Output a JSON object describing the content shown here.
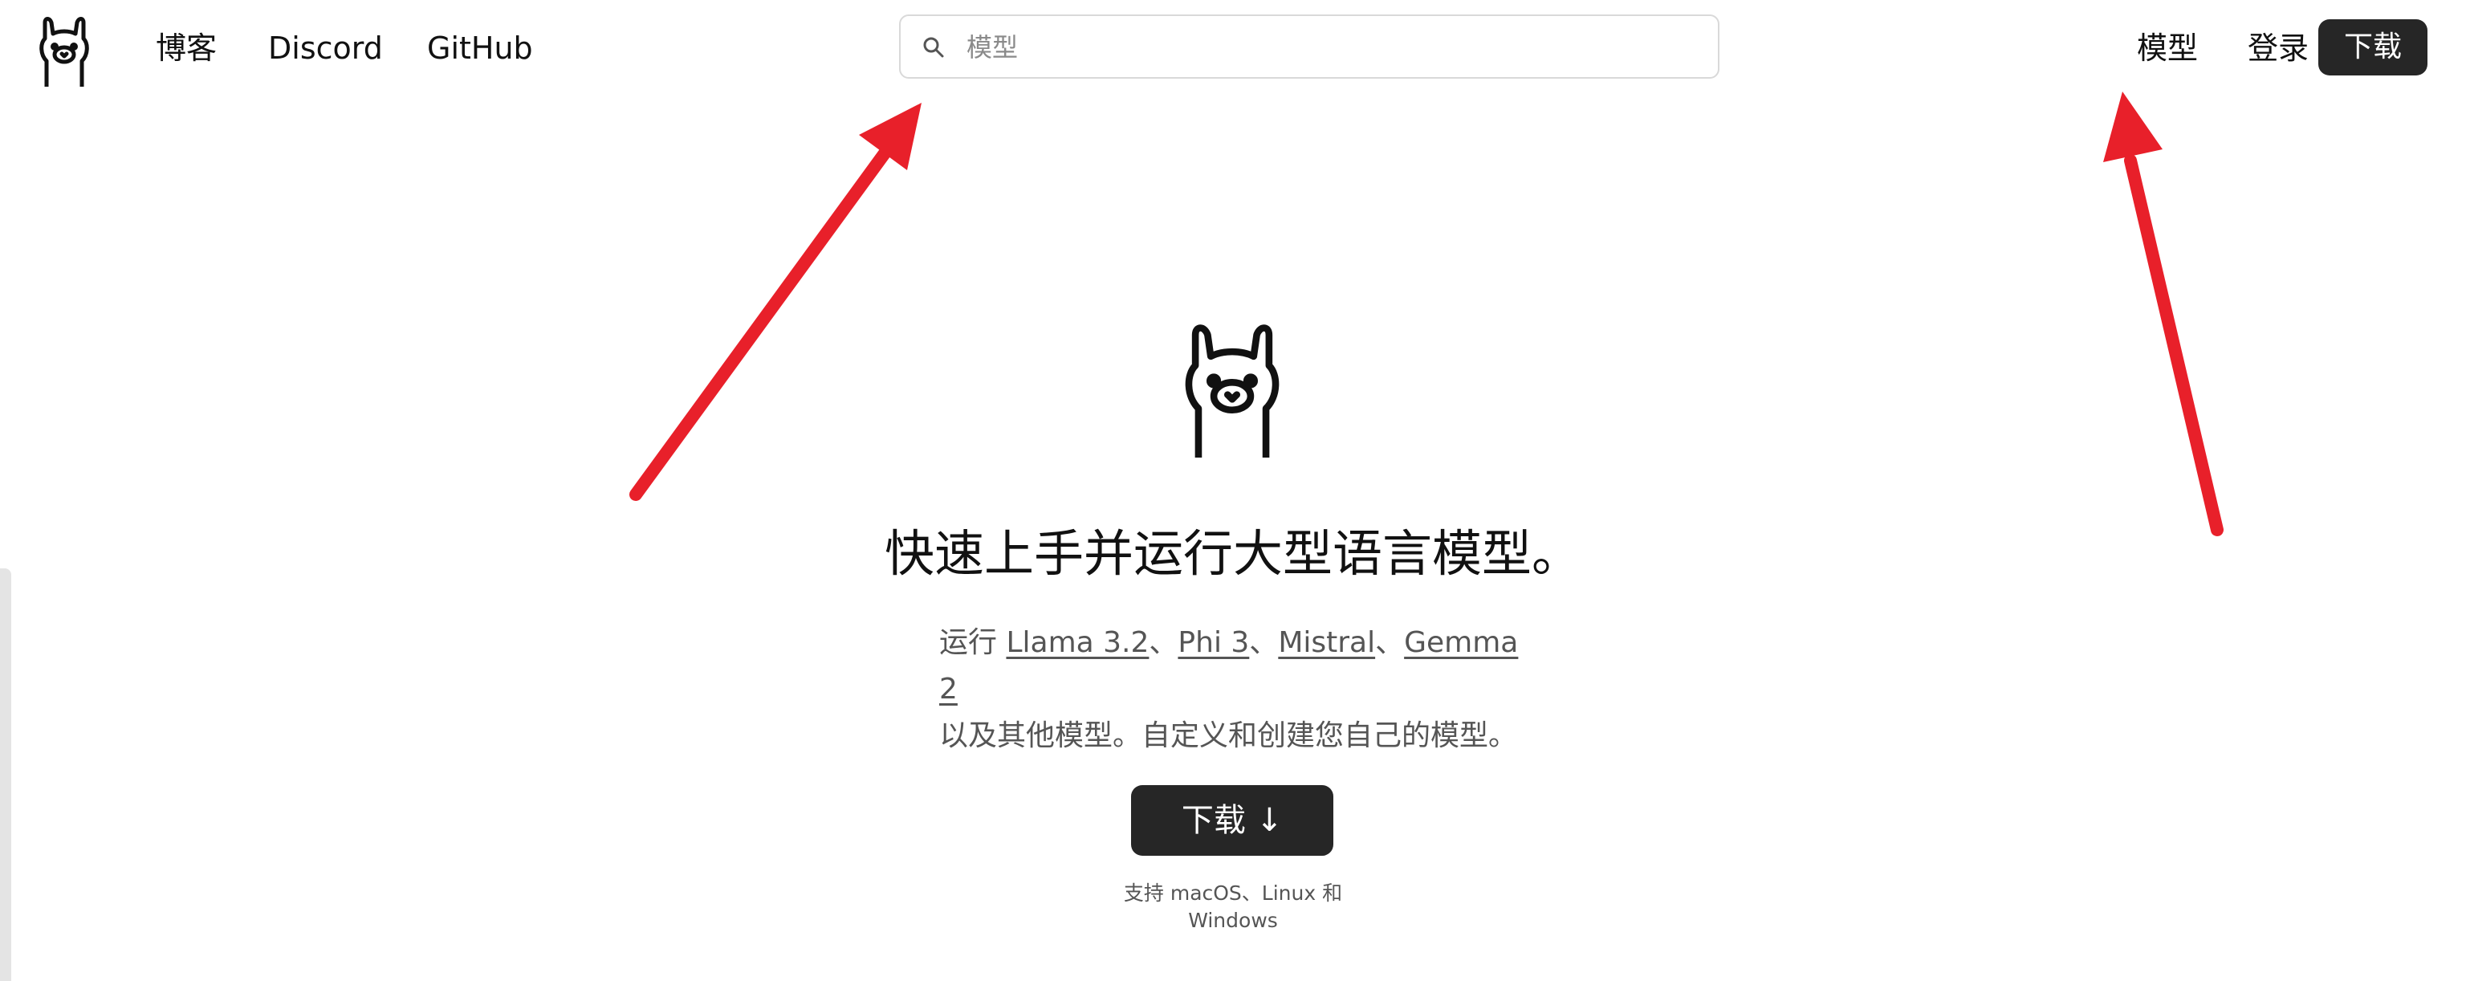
{
  "header": {
    "logo_icon": "llama-logo-icon",
    "nav": {
      "blog": "博客",
      "discord": "Discord",
      "github": "GitHub"
    },
    "search": {
      "icon": "search-icon",
      "placeholder": "模型",
      "value": ""
    },
    "right_nav": {
      "models": "模型",
      "login": "登录",
      "download": "下载"
    }
  },
  "hero": {
    "logo_icon": "llama-logo-icon",
    "title": "快速上手并运行大型语言模型。",
    "subtitle": {
      "prefix": "运行 ",
      "models": [
        "Llama 3.2",
        "Phi 3",
        "Mistral",
        "Gemma 2"
      ],
      "separator": "、",
      "suffix": "以及其他模型。自定义和创建您自己的模型。"
    },
    "download_button": "下载 ↓",
    "support_text": "支持 macOS、Linux 和 Windows"
  },
  "annotations": {
    "arrow_color": "#e8202a",
    "arrow_icon": "red-arrow-icon"
  },
  "colors": {
    "button_bg": "#262626",
    "button_text": "#ffffff",
    "muted_text": "#555555"
  }
}
